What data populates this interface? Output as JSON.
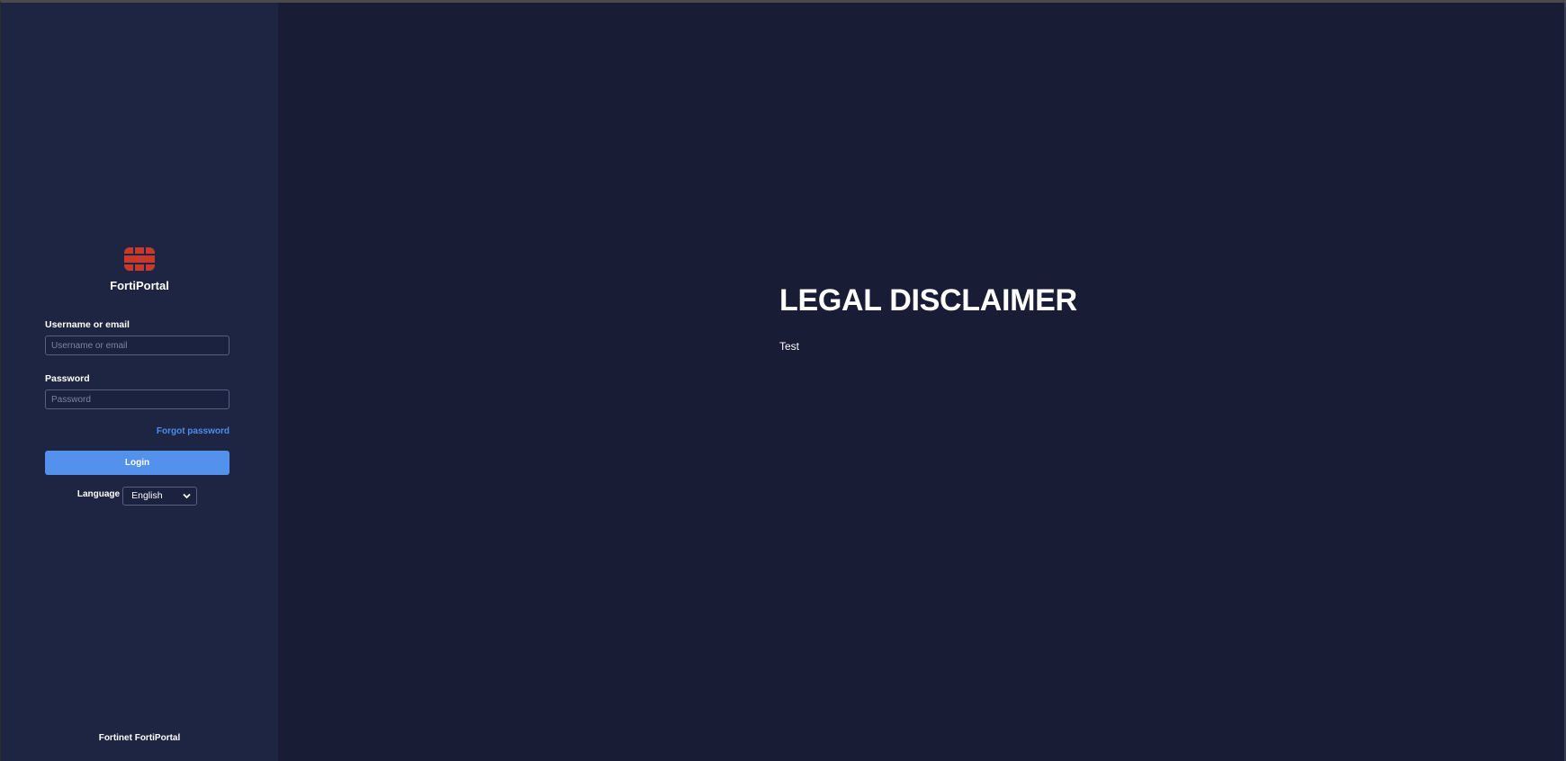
{
  "brand": {
    "name": "FortiPortal",
    "logo_icon": "fortinet-logo-icon",
    "logo_color": "#c8392b"
  },
  "login_form": {
    "username_label": "Username or email",
    "username_placeholder": "Username or email",
    "password_label": "Password",
    "password_placeholder": "Password",
    "forgot_password": "Forgot password",
    "login_button": "Login",
    "language_label": "Language",
    "language_selected": "English"
  },
  "footer": {
    "text": "Fortinet FortiPortal"
  },
  "disclaimer": {
    "title": "LEGAL DISCLAIMER",
    "body": "Test"
  },
  "colors": {
    "sidebar_bg": "#1d2542",
    "main_bg": "#181c35",
    "accent": "#5391ec",
    "link": "#4c8df0"
  }
}
